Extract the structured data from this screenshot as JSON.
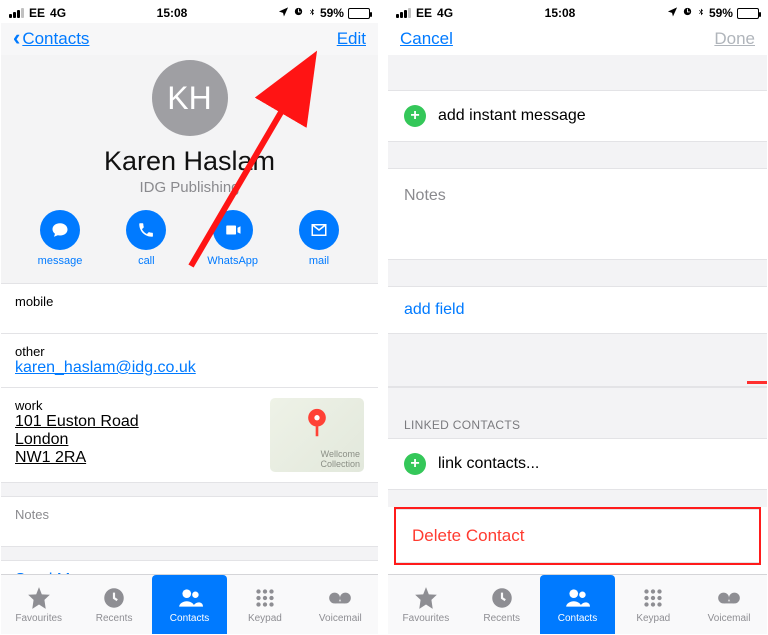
{
  "status": {
    "carrier": "EE",
    "network": "4G",
    "time": "15:08",
    "battery_pct": "59%"
  },
  "left": {
    "back_label": "Contacts",
    "edit": "Edit",
    "initials": "KH",
    "name": "Karen Haslam",
    "company": "IDG Publishing",
    "actions": {
      "message": "message",
      "call": "call",
      "whatsapp": "WhatsApp",
      "mail": "mail"
    },
    "mobile_label": "mobile",
    "other_label": "other",
    "email": "karen_haslam@idg.co.uk",
    "work_label": "work",
    "address_line1": "101 Euston Road",
    "address_city": "London",
    "address_post": "NW1 2RA",
    "map_label1": "Wellcome",
    "map_label2": "Collection",
    "notes_label": "Notes",
    "send_message": "Send Message"
  },
  "right": {
    "cancel": "Cancel",
    "done": "Done",
    "add_im": "add instant message",
    "notes_label": "Notes",
    "add_field": "add field",
    "linked_title": "LINKED CONTACTS",
    "link_contacts": "link contacts...",
    "delete": "Delete Contact"
  },
  "tabs": {
    "favourites": "Favourites",
    "recents": "Recents",
    "contacts": "Contacts",
    "keypad": "Keypad",
    "voicemail": "Voicemail"
  }
}
